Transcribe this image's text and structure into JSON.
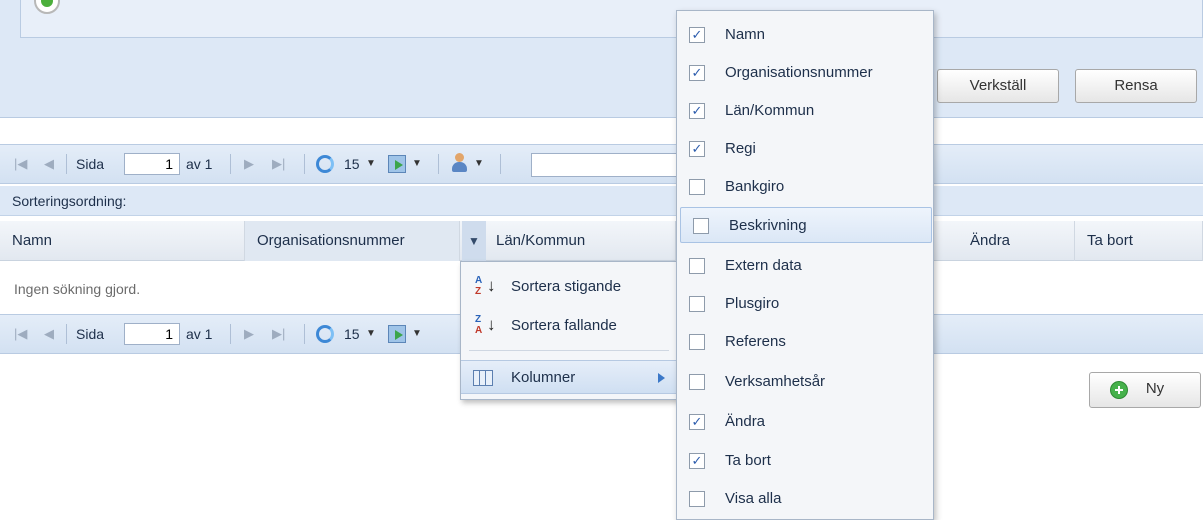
{
  "search_panel": {
    "apply_label": "Verkställ",
    "clear_label": "Rensa"
  },
  "paging_top": {
    "page_label": "Sida",
    "page_value": "1",
    "of_label": "av 1",
    "page_size": "15"
  },
  "paging_bottom": {
    "page_label": "Sida",
    "page_value": "1",
    "of_label": "av 1",
    "page_size": "15"
  },
  "sort_order_label": "Sorteringsordning:",
  "columns": {
    "namn": "Namn",
    "org": "Organisationsnummer",
    "lan": "Län/Kommun",
    "andra": "Ändra",
    "tabort": "Ta bort"
  },
  "empty_text": "Ingen sökning gjord.",
  "new_button_label": "Ny",
  "sort_menu": {
    "ascending": "Sortera stigande",
    "descending": "Sortera fallande",
    "columns": "Kolumner"
  },
  "column_menu": [
    {
      "label": "Namn",
      "checked": true
    },
    {
      "label": "Organisationsnummer",
      "checked": true
    },
    {
      "label": "Län/Kommun",
      "checked": true
    },
    {
      "label": "Regi",
      "checked": true
    },
    {
      "label": "Bankgiro",
      "checked": false
    },
    {
      "label": "Beskrivning",
      "checked": false
    },
    {
      "label": "Extern data",
      "checked": false
    },
    {
      "label": "Plusgiro",
      "checked": false
    },
    {
      "label": "Referens",
      "checked": false
    },
    {
      "label": "Verksamhetsår",
      "checked": false
    },
    {
      "label": "Ändra",
      "checked": true
    },
    {
      "label": "Ta bort",
      "checked": true
    },
    {
      "label": "Visa alla",
      "checked": false
    }
  ],
  "icons": {
    "first": "first-page-icon",
    "prev": "prev-page-icon",
    "next": "next-page-icon",
    "last": "last-page-icon",
    "refresh": "refresh-icon",
    "export": "export-icon",
    "user": "user-icon",
    "add": "add-circle-icon",
    "sort_asc": "sort-ascending-icon",
    "sort_desc": "sort-descending-icon",
    "columns": "columns-icon"
  },
  "colors": {
    "panel": "#dde8f6",
    "toolbar": "#d3e1f2",
    "check": "#2c5cad",
    "add": "#46b14b"
  }
}
